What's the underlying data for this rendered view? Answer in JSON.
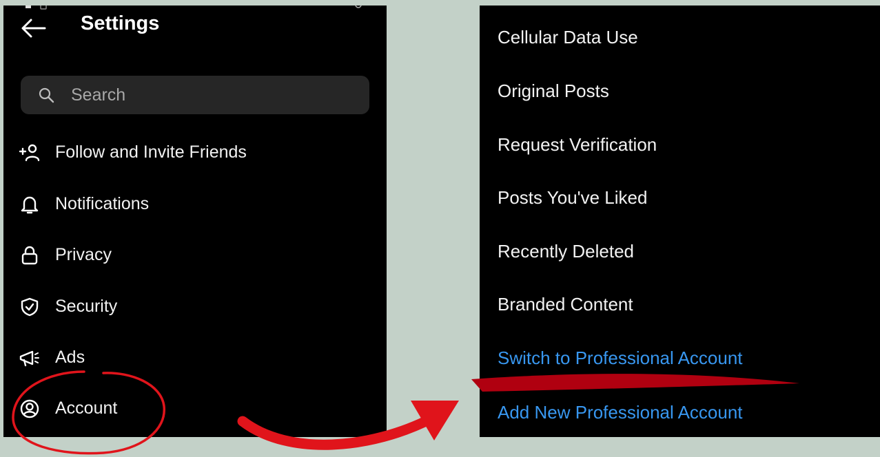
{
  "settings_screen": {
    "title": "Settings",
    "search": {
      "placeholder": "Search"
    },
    "items": [
      {
        "label": "Follow and Invite Friends",
        "icon": "add-person-icon"
      },
      {
        "label": "Notifications",
        "icon": "bell-icon"
      },
      {
        "label": "Privacy",
        "icon": "lock-icon"
      },
      {
        "label": "Security",
        "icon": "shield-check-icon"
      },
      {
        "label": "Ads",
        "icon": "megaphone-icon"
      },
      {
        "label": "Account",
        "icon": "account-circle-icon"
      }
    ]
  },
  "account_screen": {
    "items": [
      {
        "label": "Cellular Data Use"
      },
      {
        "label": "Original Posts"
      },
      {
        "label": "Request Verification"
      },
      {
        "label": "Posts You've Liked"
      },
      {
        "label": "Recently Deleted"
      },
      {
        "label": "Branded Content"
      },
      {
        "label": "Switch to Professional Account"
      },
      {
        "label": "Add New Professional Account"
      }
    ]
  },
  "colors": {
    "background": "#c3d1c8",
    "panel": "#000000",
    "link_blue": "#3897f0",
    "annotation_red": "#e0141b",
    "underline_red": "#b00010"
  }
}
